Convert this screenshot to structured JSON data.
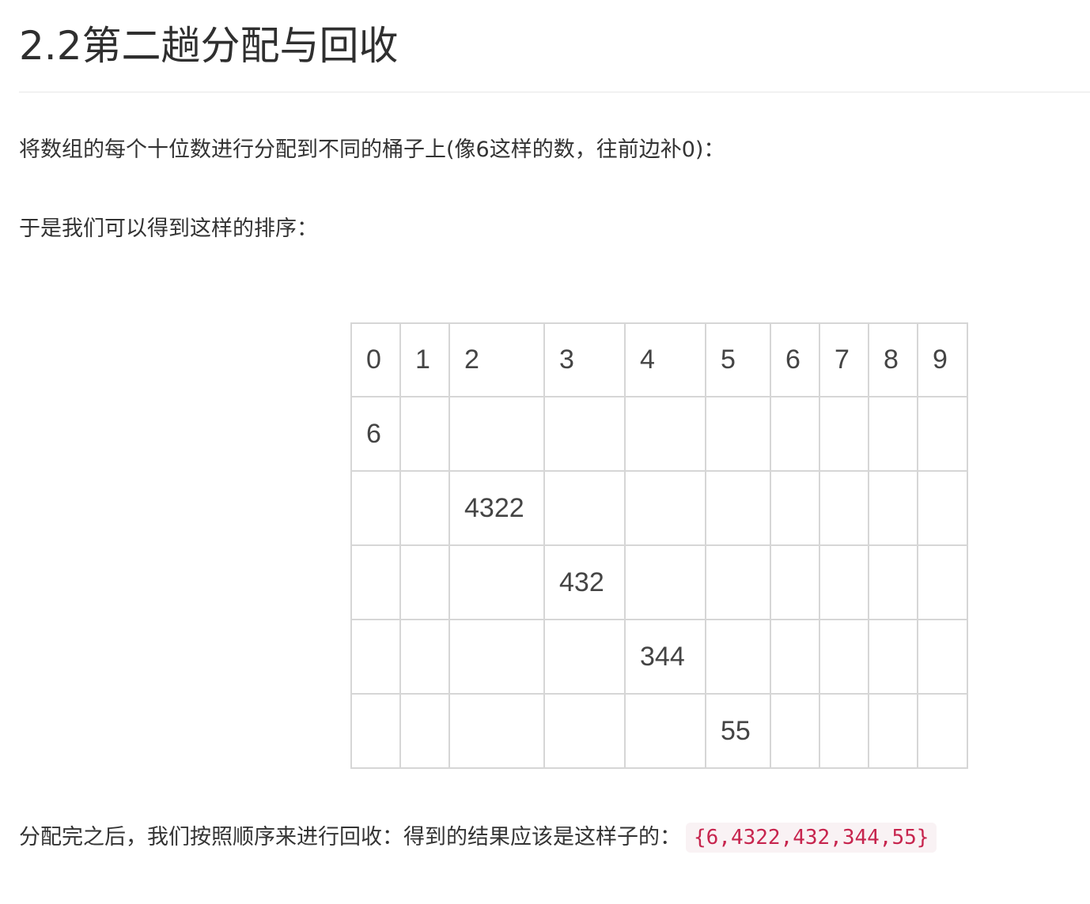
{
  "heading": "2.2第二趟分配与回收",
  "paragraphs": {
    "intro": "将数组的每个十位数进行分配到不同的桶子上(像6这样的数，往前边补0)：",
    "result_intro": "于是我们可以得到这样的排序：",
    "conclusion": "分配完之后，我们按照顺序来进行回收：得到的结果应该是这样子的：",
    "conclusion_code": "{6,4322,432,344,55}"
  },
  "bucket_table": {
    "headers": [
      "0",
      "1",
      "2",
      "3",
      "4",
      "5",
      "6",
      "7",
      "8",
      "9"
    ],
    "rows": [
      [
        "6",
        "",
        "",
        "",
        "",
        "",
        "",
        "",
        "",
        ""
      ],
      [
        "",
        "",
        "4322",
        "",
        "",
        "",
        "",
        "",
        "",
        ""
      ],
      [
        "",
        "",
        "",
        "432",
        "",
        "",
        "",
        "",
        "",
        ""
      ],
      [
        "",
        "",
        "",
        "",
        "344",
        "",
        "",
        "",
        "",
        ""
      ],
      [
        "",
        "",
        "",
        "",
        "",
        "55",
        "",
        "",
        "",
        ""
      ]
    ]
  }
}
